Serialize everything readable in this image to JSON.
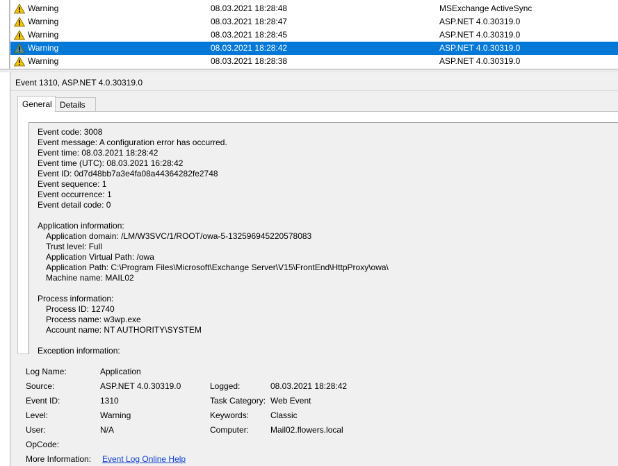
{
  "events": [
    {
      "level": "Warning",
      "datetime": "08.03.2021 18:28:48",
      "source": "MSExchange ActiveSync",
      "selected": false
    },
    {
      "level": "Warning",
      "datetime": "08.03.2021 18:28:47",
      "source": "ASP.NET 4.0.30319.0",
      "selected": false
    },
    {
      "level": "Warning",
      "datetime": "08.03.2021 18:28:45",
      "source": "ASP.NET 4.0.30319.0",
      "selected": false
    },
    {
      "level": "Warning",
      "datetime": "08.03.2021 18:28:42",
      "source": "ASP.NET 4.0.30319.0",
      "selected": true
    },
    {
      "level": "Warning",
      "datetime": "08.03.2021 18:28:38",
      "source": "ASP.NET 4.0.30319.0",
      "selected": false
    }
  ],
  "detail": {
    "title": "Event 1310, ASP.NET 4.0.30319.0",
    "tabs": {
      "general": "General",
      "details": "Details"
    },
    "description": [
      {
        "text": "Event code: 3008",
        "indent": false
      },
      {
        "text": "Event message: A configuration error has occurred.",
        "indent": false
      },
      {
        "text": "Event time: 08.03.2021 18:28:42",
        "indent": false
      },
      {
        "text": "Event time (UTC): 08.03.2021 16:28:42",
        "indent": false
      },
      {
        "text": "Event ID: 0d7d48bb7a3e4fa08a44364282fe2748",
        "indent": false
      },
      {
        "text": "Event sequence: 1",
        "indent": false
      },
      {
        "text": "Event occurrence: 1",
        "indent": false
      },
      {
        "text": "Event detail code: 0",
        "indent": false
      },
      {
        "text": "",
        "indent": false
      },
      {
        "text": "Application information:",
        "indent": false
      },
      {
        "text": "Application domain: /LM/W3SVC/1/ROOT/owa-5-132596945220578083",
        "indent": true
      },
      {
        "text": "Trust level: Full",
        "indent": true
      },
      {
        "text": "Application Virtual Path: /owa",
        "indent": true
      },
      {
        "text": "Application Path: C:\\Program Files\\Microsoft\\Exchange Server\\V15\\FrontEnd\\HttpProxy\\owa\\",
        "indent": true
      },
      {
        "text": "Machine name: MAIL02",
        "indent": true
      },
      {
        "text": "",
        "indent": false
      },
      {
        "text": "Process information:",
        "indent": false
      },
      {
        "text": "Process ID: 12740",
        "indent": true
      },
      {
        "text": "Process name: w3wp.exe",
        "indent": true
      },
      {
        "text": "Account name: NT AUTHORITY\\SYSTEM",
        "indent": true
      },
      {
        "text": "",
        "indent": false
      },
      {
        "text": "Exception information:",
        "indent": false
      }
    ],
    "properties": {
      "log_name_label": "Log Name:",
      "log_name": "Application",
      "source_label": "Source:",
      "source": "ASP.NET 4.0.30319.0",
      "logged_label": "Logged:",
      "logged": "08.03.2021 18:28:42",
      "event_id_label": "Event ID:",
      "event_id": "1310",
      "task_category_label": "Task Category:",
      "task_category": "Web Event",
      "level_label": "Level:",
      "level": "Warning",
      "keywords_label": "Keywords:",
      "keywords": "Classic",
      "user_label": "User:",
      "user": "N/A",
      "computer_label": "Computer:",
      "computer": "Mail02.flowers.local",
      "opcode_label": "OpCode:",
      "opcode": "",
      "more_info_label": "More Information:",
      "more_info_link": "Event Log Online Help"
    }
  },
  "colors": {
    "selection": "#0078d7",
    "warning_icon": "#f5c400",
    "link": "#0b3fd1"
  },
  "icons": {
    "level": "warning-icon"
  }
}
